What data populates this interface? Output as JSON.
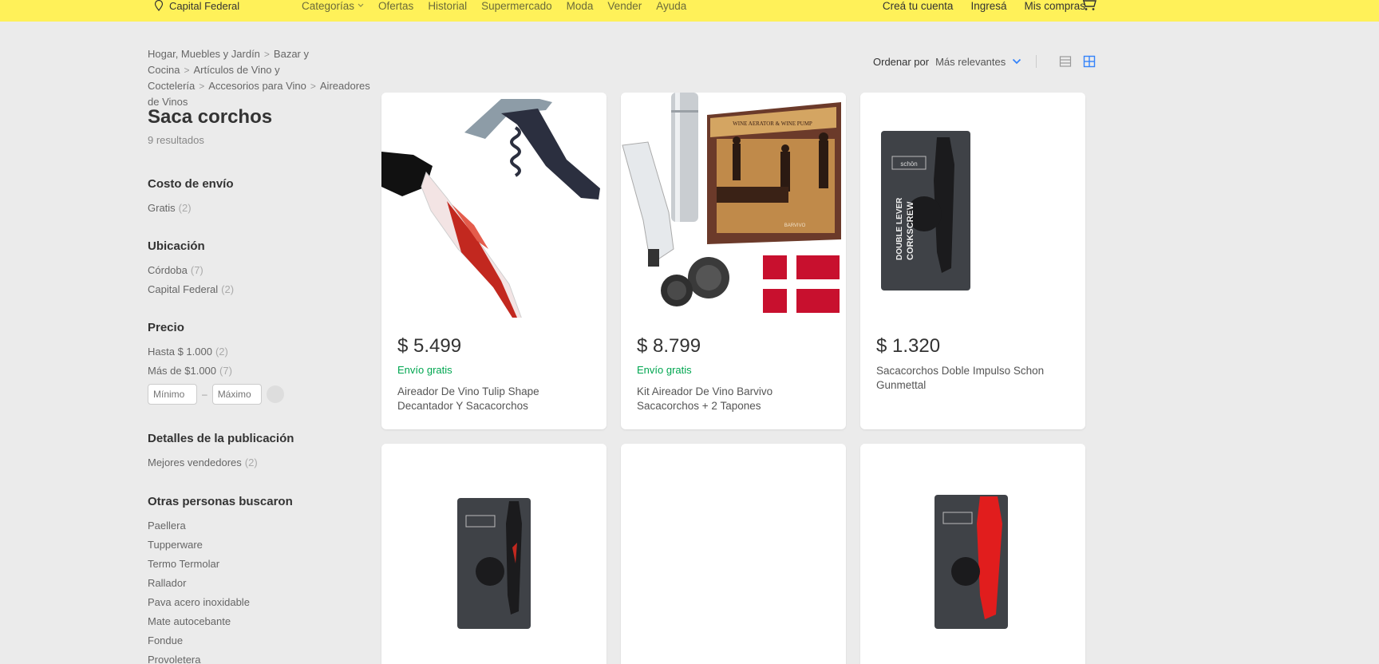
{
  "header": {
    "location": "Capital Federal",
    "nav": [
      "Categorías",
      "Ofertas",
      "Historial",
      "Supermercado",
      "Moda",
      "Vender",
      "Ayuda"
    ],
    "account": [
      "Creá tu cuenta",
      "Ingresá",
      "Mis compras"
    ]
  },
  "breadcrumb": [
    "Hogar, Muebles y Jardín",
    "Bazar y Cocina",
    "Artículos de Vino y Coctelería",
    "Accesorios para Vino",
    "Aireadores de Vinos"
  ],
  "page": {
    "title": "Saca corchos",
    "results": "9 resultados"
  },
  "filters": {
    "shipping": {
      "title": "Costo de envío",
      "items": [
        {
          "label": "Gratis",
          "count": "(2)"
        }
      ]
    },
    "location": {
      "title": "Ubicación",
      "items": [
        {
          "label": "Córdoba",
          "count": "(7)"
        },
        {
          "label": "Capital Federal",
          "count": "(2)"
        }
      ]
    },
    "price": {
      "title": "Precio",
      "items": [
        {
          "label": "Hasta $ 1.000",
          "count": "(2)"
        },
        {
          "label": "Más de $1.000",
          "count": "(7)"
        }
      ],
      "min_placeholder": "Mínimo",
      "max_placeholder": "Máximo"
    },
    "details": {
      "title": "Detalles de la publicación",
      "items": [
        {
          "label": "Mejores vendedores",
          "count": "(2)"
        }
      ]
    },
    "others": {
      "title": "Otras personas buscaron",
      "items": [
        "Paellera",
        "Tupperware",
        "Termo Termolar",
        "Rallador",
        "Pava acero inoxidable",
        "Mate autocebante",
        "Fondue",
        "Provoletera"
      ]
    }
  },
  "sort": {
    "label": "Ordenar por",
    "value": "Más relevantes"
  },
  "products": [
    {
      "price": "$ 5.499",
      "shipping": "Envío gratis",
      "name": "Aireador De Vino Tulip Shape Decantador Y Sacacorchos"
    },
    {
      "price": "$ 8.799",
      "shipping": "Envío gratis",
      "name": "Kit Aireador De Vino Barvivo Sacacorchos + 2 Tapones"
    },
    {
      "price": "$ 1.320",
      "shipping": "",
      "name": "Sacacorchos Doble Impulso Schon Gunmettal"
    }
  ],
  "image_text": {
    "kit_box": "WINE AERATOR & WINE PUMP",
    "kit_brand": "BARVIVO",
    "package_brand": "schön",
    "package_line1": "DOUBLE LEVER",
    "package_line2": "CORKSCREW"
  },
  "colors": {
    "topbar": "#fff159",
    "ship": "#00a650",
    "accent": "#3483fa"
  }
}
